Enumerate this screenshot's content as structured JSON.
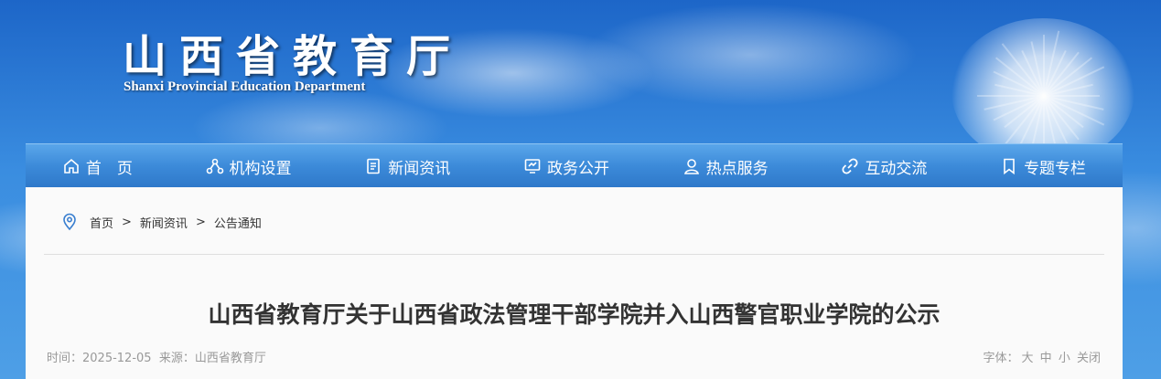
{
  "header": {
    "title_cn": "山西省教育厅",
    "title_en": "Shanxi Provincial Education Department"
  },
  "nav": {
    "items": [
      {
        "label": "首　页",
        "icon": "home-icon"
      },
      {
        "label": "机构设置",
        "icon": "org-icon"
      },
      {
        "label": "新闻资讯",
        "icon": "document-icon"
      },
      {
        "label": "政务公开",
        "icon": "board-icon"
      },
      {
        "label": "热点服务",
        "icon": "user-icon"
      },
      {
        "label": "互动交流",
        "icon": "link-icon"
      },
      {
        "label": "专题专栏",
        "icon": "bookmark-icon"
      }
    ]
  },
  "breadcrumb": {
    "items": [
      "首页",
      "新闻资讯",
      "公告通知"
    ],
    "separator": ">"
  },
  "article": {
    "title": "山西省教育厅关于山西省政法管理干部学院并入山西警官职业学院的公示",
    "time_label": "时间：",
    "time": "2025-12-05",
    "source_label": "来源：",
    "source": "山西省教育厅",
    "font_label": "字体：",
    "font_large": "大",
    "font_medium": "中",
    "font_small": "小",
    "close": "关闭"
  },
  "colors": {
    "nav_bg": "#3c8ad9",
    "accent": "#3a8de0",
    "title_text": "#333333",
    "meta_text": "#999999"
  }
}
